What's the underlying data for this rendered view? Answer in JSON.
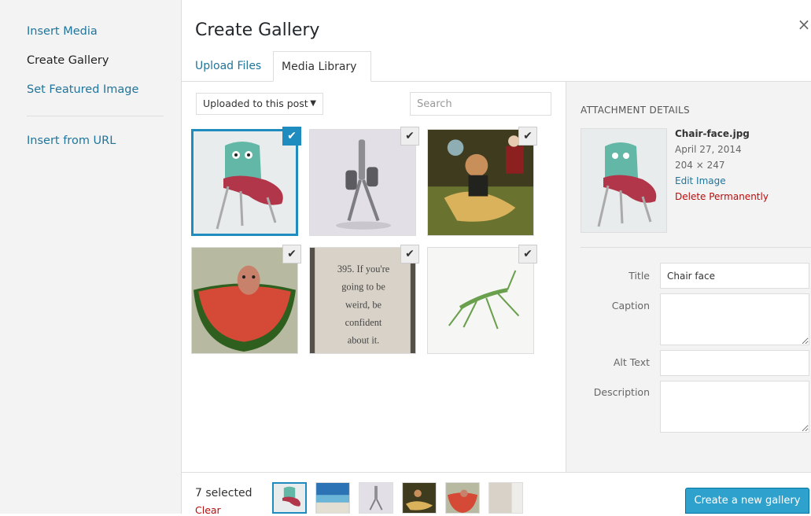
{
  "menu": {
    "insert_media": "Insert Media",
    "create_gallery": "Create Gallery",
    "set_featured_image": "Set Featured Image",
    "insert_from_url": "Insert from URL"
  },
  "title": "Create Gallery",
  "close_icon": "×",
  "tabs": {
    "upload_files": "Upload Files",
    "media_library": "Media Library"
  },
  "filter": {
    "selected": "Uploaded to this post",
    "arrow": "▼"
  },
  "search": {
    "placeholder": "Search"
  },
  "check_glyph": "✔",
  "details": {
    "heading": "ATTACHMENT DETAILS",
    "filename": "Chair-face.jpg",
    "date": "April 27, 2014",
    "dimensions": "204 × 247",
    "edit_image": "Edit Image",
    "delete_permanently": "Delete Permanently",
    "title_label": "Title",
    "title_value": "Chair face",
    "caption_label": "Caption",
    "alt_text_label": "Alt Text",
    "description_label": "Description"
  },
  "thumbs": {
    "text_card": [
      "395. If you're",
      "going to be",
      "weird, be",
      "confident",
      "about it."
    ]
  },
  "toolbar": {
    "selected_count": "7 selected",
    "clear": "Clear",
    "create_button": "Create a new gallery"
  },
  "colors": {
    "accent": "#1e8cbe",
    "link": "#21759b",
    "delete": "#bc0b0b",
    "button": "#2ea2cc"
  }
}
